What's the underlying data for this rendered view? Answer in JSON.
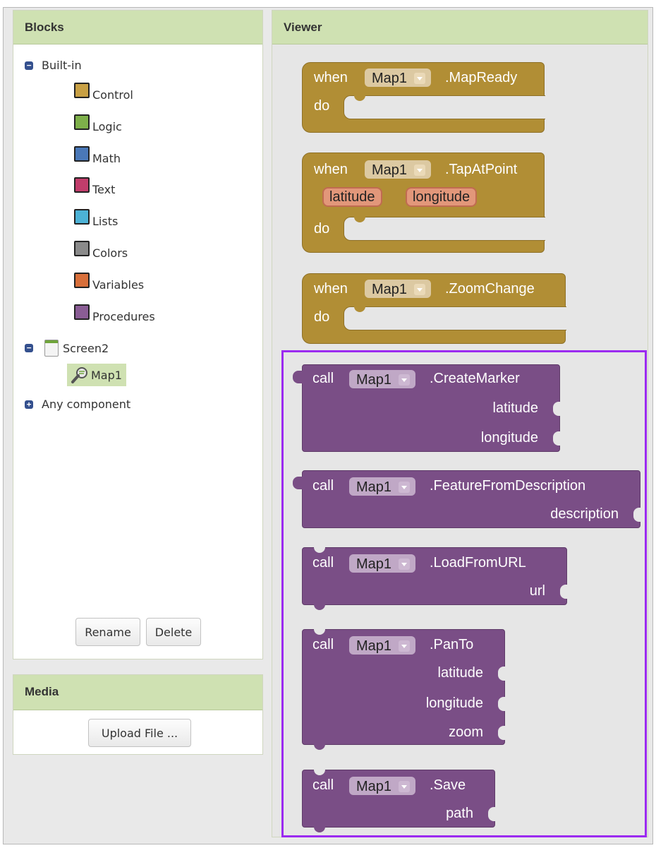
{
  "blocks_panel": {
    "title": "Blocks",
    "builtin_label": "Built-in",
    "builtin_toggle": "−",
    "categories": [
      {
        "label": "Control",
        "color": "#c8a044"
      },
      {
        "label": "Logic",
        "color": "#7eb04a"
      },
      {
        "label": "Math",
        "color": "#4a78b8"
      },
      {
        "label": "Text",
        "color": "#c13d6b"
      },
      {
        "label": "Lists",
        "color": "#4cb2d6"
      },
      {
        "label": "Colors",
        "color": "#8a8a8a"
      },
      {
        "label": "Variables",
        "color": "#d86f3a"
      },
      {
        "label": "Procedures",
        "color": "#8a5d95"
      }
    ],
    "screen_label": "Screen2",
    "screen_toggle": "−",
    "component_label": "Map1",
    "any_component_label": "Any component",
    "any_component_toggle": "+",
    "rename_label": "Rename",
    "delete_label": "Delete"
  },
  "media_panel": {
    "title": "Media",
    "upload_label": "Upload File ..."
  },
  "viewer": {
    "title": "Viewer",
    "events": [
      {
        "when": "when",
        "component": "Map1",
        "event": ".MapReady",
        "params": [],
        "do": "do"
      },
      {
        "when": "when",
        "component": "Map1",
        "event": ".TapAtPoint",
        "params": [
          "latitude",
          "longitude"
        ],
        "do": "do"
      },
      {
        "when": "when",
        "component": "Map1",
        "event": ".ZoomChange",
        "params": [],
        "do": "do"
      }
    ],
    "calls": [
      {
        "call": "call",
        "component": "Map1",
        "method": ".CreateMarker",
        "args": [
          "latitude",
          "longitude"
        ]
      },
      {
        "call": "call",
        "component": "Map1",
        "method": ".FeatureFromDescription",
        "args": [
          "description"
        ]
      },
      {
        "call": "call",
        "component": "Map1",
        "method": ".LoadFromURL",
        "args": [
          "url"
        ]
      },
      {
        "call": "call",
        "component": "Map1",
        "method": ".PanTo",
        "args": [
          "latitude",
          "longitude",
          "zoom"
        ]
      },
      {
        "call": "call",
        "component": "Map1",
        "method": ".Save",
        "args": [
          "path"
        ]
      }
    ],
    "selection_color": "#9b2bf0"
  }
}
